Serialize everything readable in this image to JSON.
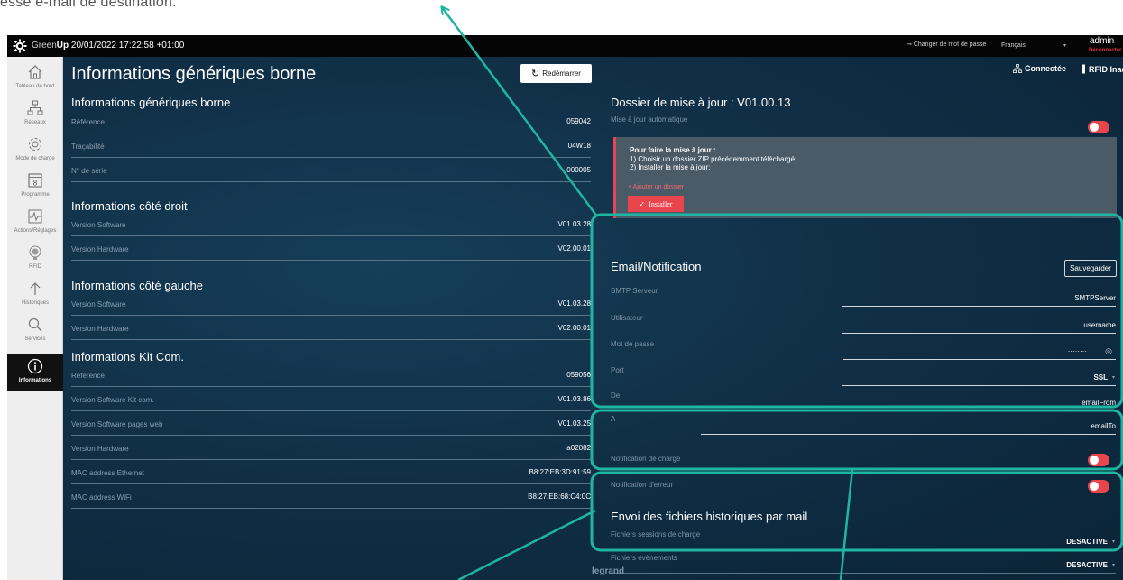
{
  "doc_caption": "esse e-mail de destination.",
  "topbar": {
    "brand_green": "Green",
    "brand_up": "Up",
    "datetime": "20/01/2022 17:22:58 +01:00",
    "change_password": "Changer de mot de passe",
    "language": "Français",
    "user": "admin",
    "logout": "Déconnecter"
  },
  "sidebar": {
    "items": [
      {
        "label": "Tableau de bord",
        "icon": "home-icon"
      },
      {
        "label": "Réseaux",
        "icon": "network-icon"
      },
      {
        "label": "Mode de charge",
        "icon": "gear-icon"
      },
      {
        "label": "Programme",
        "icon": "calendar-icon",
        "day": "8"
      },
      {
        "label": "Actions/Réglages",
        "icon": "pulse-icon"
      },
      {
        "label": "RFID",
        "icon": "rfid-icon"
      },
      {
        "label": "Historiques",
        "icon": "upload-arrow-icon"
      },
      {
        "label": "Services",
        "icon": "search-icon"
      },
      {
        "label": "Informations",
        "icon": "info-icon"
      }
    ]
  },
  "header": {
    "title": "Informations génériques borne",
    "restart_label": "Redémarrer",
    "connected_label": "Connectée",
    "rfid_label": "RFID Inac"
  },
  "left": {
    "generic": {
      "title": "Informations génériques borne",
      "rows": [
        {
          "label": "Référence",
          "value": "059042"
        },
        {
          "label": "Traçabilité",
          "value": "04W18"
        },
        {
          "label": "N° de série",
          "value": "000005"
        }
      ]
    },
    "right_side": {
      "title": "Informations côté droit",
      "rows": [
        {
          "label": "Version Software",
          "value": "V01.03.28"
        },
        {
          "label": "Version Hardware",
          "value": "V02.00.01"
        }
      ]
    },
    "left_side": {
      "title": "Informations côté gauche",
      "rows": [
        {
          "label": "Version Software",
          "value": "V01.03.28"
        },
        {
          "label": "Version Hardware",
          "value": "V02.00.01"
        }
      ]
    },
    "kit": {
      "title": "Informations Kit Com.",
      "rows": [
        {
          "label": "Référence",
          "value": "059056"
        },
        {
          "label": "Version Software Kit com.",
          "value": "V01.03.86"
        },
        {
          "label": "Version Software pages web",
          "value": "V01.03.25"
        },
        {
          "label": "Version Hardware",
          "value": "a02082"
        },
        {
          "label": "MAC address Ethernet",
          "value": "B8:27:EB:3D:91:59"
        },
        {
          "label": "MAC address WiFi",
          "value": "B8:27:EB:68:C4:0C"
        }
      ]
    }
  },
  "update": {
    "title": "Dossier de mise à jour : V01.00.13",
    "auto_label": "Mise à jour automatique",
    "box_title": "Pour faire la mise à jour :",
    "step1": "1) Choisir un dossier ZIP précédemment téléchargé;",
    "step2": "2) Installer la mise à jour;",
    "add_folder": "+ Ajouter un dossier",
    "install_label": "Installer"
  },
  "email": {
    "title": "Email/Notification",
    "save_label": "Sauvegarder",
    "smtp_label": "SMTP Serveur",
    "smtp_value": "SMTPServer",
    "user_label": "Utilisateur",
    "user_value": "username",
    "password_label": "Mot de passe",
    "password_value": "········",
    "port_label": "Port",
    "port_value": "SSL",
    "from_label": "De",
    "from_value": "emailFrom",
    "to_label": "A",
    "to_value": "emailTo"
  },
  "notifications": {
    "charge_label": "Notification de charge",
    "error_label": "Notification d'erreur"
  },
  "history": {
    "title": "Envoi des fichiers historiques par mail",
    "sessions_label": "Fichiers sessions de charge",
    "sessions_value": "DESACTIVE",
    "events_label": "Fichiers évènements",
    "events_value": "DESACTIVE"
  },
  "footer": {
    "brand": "legrand"
  },
  "colors": {
    "accent_teal": "#1fb5a3",
    "toggle_red": "#e8454d",
    "background_navy": "#0f2d44"
  }
}
